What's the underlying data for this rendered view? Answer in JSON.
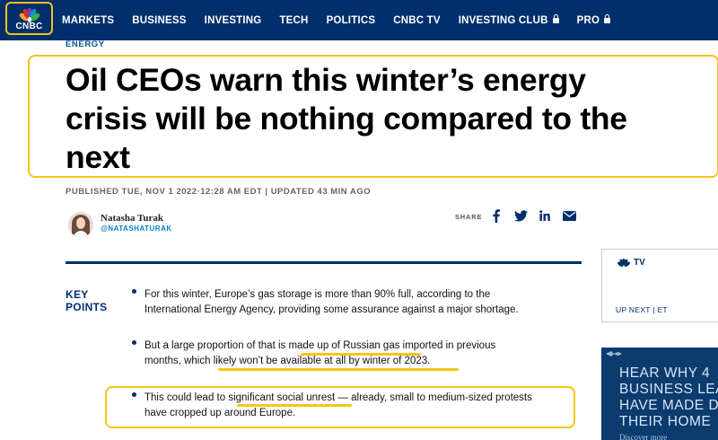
{
  "brand": {
    "logo_text": "CNBC",
    "primary_color": "#002f6c",
    "accent_color": "#f5c518",
    "link_color": "#0a7ec2"
  },
  "nav": {
    "items": [
      {
        "label": "MARKETS",
        "locked": false
      },
      {
        "label": "BUSINESS",
        "locked": false
      },
      {
        "label": "INVESTING",
        "locked": false
      },
      {
        "label": "TECH",
        "locked": false
      },
      {
        "label": "POLITICS",
        "locked": false
      },
      {
        "label": "CNBC TV",
        "locked": false
      },
      {
        "label": "INVESTING CLUB",
        "locked": true
      },
      {
        "label": "PRO",
        "locked": true
      }
    ]
  },
  "article": {
    "section": "ENERGY",
    "headline_lines": [
      "Oil CEOs warn this winter’s energy",
      "crisis will be nothing compared to the",
      "next"
    ],
    "published": "PUBLISHED TUE, NOV 1 2022·12:28 AM EDT | UPDATED 43 MIN AGO",
    "author": {
      "name": "Natasha Turak",
      "handle": "@NATASHATURAK"
    },
    "share": {
      "label": "SHARE",
      "icons": [
        "facebook-icon",
        "twitter-icon",
        "linkedin-icon",
        "email-icon"
      ]
    }
  },
  "key_points": {
    "title_line1": "KEY",
    "title_line2": "POINTS",
    "items": [
      {
        "line1": "For this winter, Europe’s gas storage is more than 90% full, according to the",
        "line2": "International Energy Agency, providing some assurance against a major shortage."
      },
      {
        "line1": "But a large proportion of that is made up of Russian gas imported in previous",
        "line2": "months, which likely won’t be available at all by winter of 2023."
      },
      {
        "line1": "This could lead to significant social unrest — already, small to medium-sized protests",
        "line2": "have cropped up around Europe."
      }
    ]
  },
  "rail": {
    "tv_label": "TV",
    "tv_up_next": "UP NEXT | ET",
    "ad_lines": [
      "HEAR WHY 4",
      "BUSINESS LEAD",
      "HAVE MADE DU",
      "THEIR HOME"
    ],
    "ad_sub": "Discover more"
  }
}
